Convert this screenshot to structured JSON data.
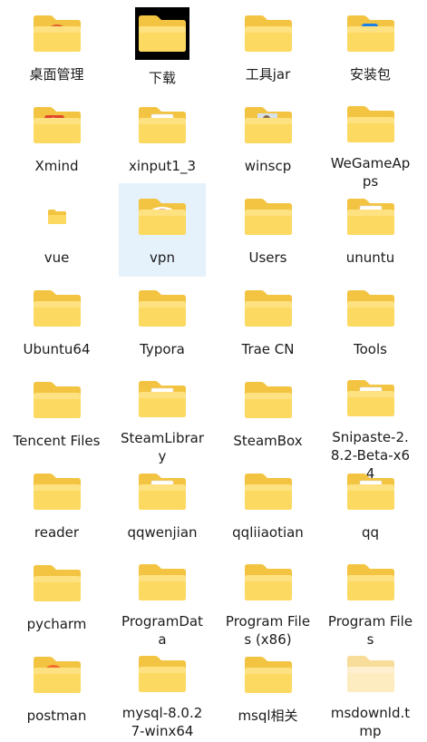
{
  "items": [
    {
      "label": "桌面管理",
      "overlay": "disc-white-icon",
      "selected": false
    },
    {
      "label": "下载",
      "overlay": "edge-swirl-icon",
      "selected": false,
      "dark": true
    },
    {
      "label": "工具jar",
      "overlay": "none",
      "selected": false
    },
    {
      "label": "安装包",
      "overlay": "blue-app-icon",
      "selected": false
    },
    {
      "label": "Xmind",
      "overlay": "red-app-icon",
      "selected": false
    },
    {
      "label": "xinput1_3",
      "overlay": "white-paper-icon",
      "selected": false
    },
    {
      "label": "winscp",
      "overlay": "person-photo-icon",
      "selected": false
    },
    {
      "label": "WeGameApps",
      "overlay": "none",
      "selected": false
    },
    {
      "label": "vue",
      "overlay": "none",
      "selected": false,
      "small": true
    },
    {
      "label": "vpn",
      "overlay": "red-badge-icon",
      "selected": true
    },
    {
      "label": "Users",
      "overlay": "none",
      "selected": false
    },
    {
      "label": "ununtu",
      "overlay": "white-paper-icon",
      "selected": false
    },
    {
      "label": "Ubuntu64",
      "overlay": "none",
      "selected": false
    },
    {
      "label": "Typora",
      "overlay": "blue-arrow-disc-icon",
      "selected": false
    },
    {
      "label": "Trae CN",
      "overlay": "blue-arrow-disc-icon",
      "selected": false
    },
    {
      "label": "Tools",
      "overlay": "none",
      "selected": false
    },
    {
      "label": "Tencent Files",
      "overlay": "none",
      "selected": false
    },
    {
      "label": "SteamLibrary",
      "overlay": "white-paper-icon",
      "selected": false
    },
    {
      "label": "SteamBox",
      "overlay": "small-paper-icon",
      "selected": false
    },
    {
      "label": "Snipaste-2.8.2-Beta-x64",
      "overlay": "white-paper-icon",
      "selected": false
    },
    {
      "label": "reader",
      "overlay": "none",
      "selected": false
    },
    {
      "label": "qqwenjian",
      "overlay": "white-paper-icon",
      "selected": false
    },
    {
      "label": "qqliiaotian",
      "overlay": "none",
      "selected": false
    },
    {
      "label": "qq",
      "overlay": "white-paper-icon",
      "selected": false
    },
    {
      "label": "pycharm",
      "overlay": "dark-app-icon",
      "selected": false
    },
    {
      "label": "ProgramData",
      "overlay": "none",
      "selected": false
    },
    {
      "label": "Program Files (x86)",
      "overlay": "none",
      "selected": false
    },
    {
      "label": "Program Files",
      "overlay": "none",
      "selected": false
    },
    {
      "label": "postman",
      "overlay": "orange-disc-icon",
      "selected": false
    },
    {
      "label": "mysql-8.0.27-winx64",
      "overlay": "dark-app-icon",
      "selected": false
    },
    {
      "label": "msql相关",
      "overlay": "none",
      "selected": false
    },
    {
      "label": "msdownld.tmp",
      "overlay": "none",
      "selected": false,
      "faded": true
    }
  ],
  "colors": {
    "folder_back": "#f3c441",
    "folder_front": "#fcd960",
    "folder_front_light": "#ffe79a",
    "selection": "#e5f1fb"
  }
}
